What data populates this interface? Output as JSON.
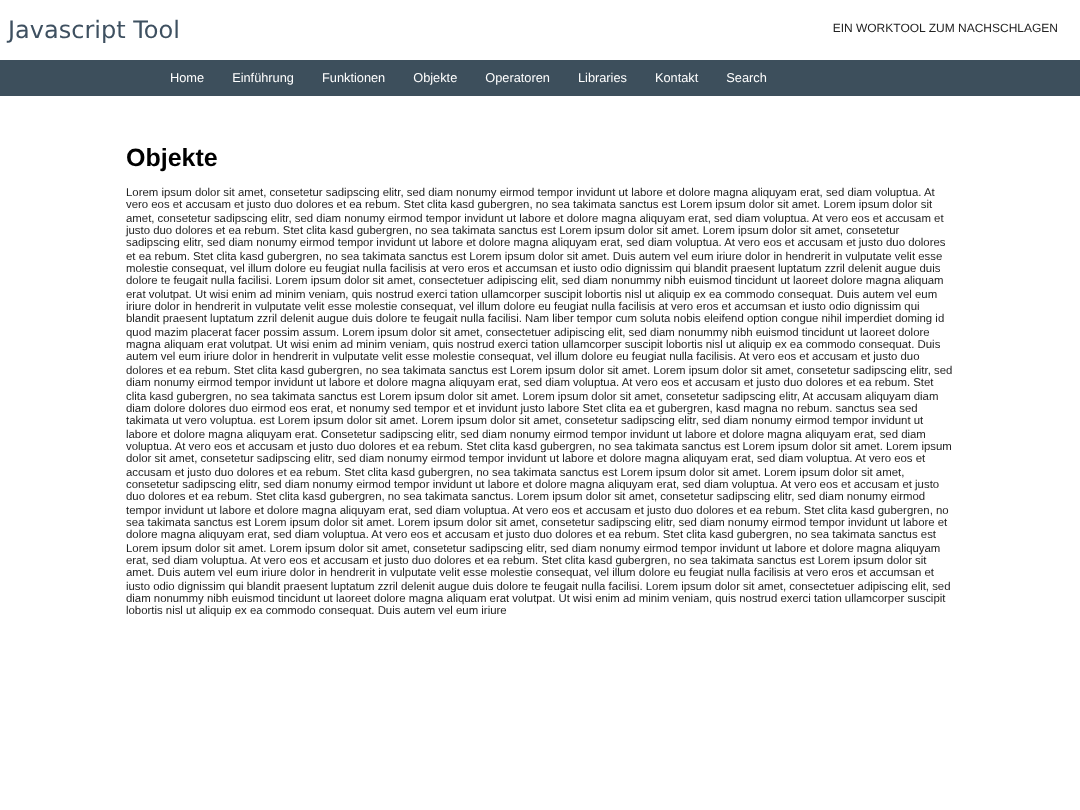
{
  "header": {
    "title": "Javascript Tool",
    "tagline": "EIN WORKTOOL ZUM NACHSCHLAGEN"
  },
  "nav": [
    {
      "label": "Home"
    },
    {
      "label": "Einführung"
    },
    {
      "label": "Funktionen"
    },
    {
      "label": "Objekte"
    },
    {
      "label": "Operatoren"
    },
    {
      "label": "Libraries"
    },
    {
      "label": "Kontakt"
    },
    {
      "label": "Search"
    }
  ],
  "content": {
    "heading": "Objekte",
    "paragraph": "Lorem ipsum dolor sit amet, consetetur sadipscing elitr, sed diam nonumy eirmod tempor invidunt ut labore et dolore magna aliquyam erat, sed diam voluptua. At vero eos et accusam et justo duo dolores et ea rebum. Stet clita kasd gubergren, no sea takimata sanctus est Lorem ipsum dolor sit amet. Lorem ipsum dolor sit amet, consetetur sadipscing elitr, sed diam nonumy eirmod tempor invidunt ut labore et dolore magna aliquyam erat, sed diam voluptua. At vero eos et accusam et justo duo dolores et ea rebum. Stet clita kasd gubergren, no sea takimata sanctus est Lorem ipsum dolor sit amet. Lorem ipsum dolor sit amet, consetetur sadipscing elitr, sed diam nonumy eirmod tempor invidunt ut labore et dolore magna aliquyam erat, sed diam voluptua. At vero eos et accusam et justo duo dolores et ea rebum. Stet clita kasd gubergren, no sea takimata sanctus est Lorem ipsum dolor sit amet. Duis autem vel eum iriure dolor in hendrerit in vulputate velit esse molestie consequat, vel illum dolore eu feugiat nulla facilisis at vero eros et accumsan et iusto odio dignissim qui blandit praesent luptatum zzril delenit augue duis dolore te feugait nulla facilisi. Lorem ipsum dolor sit amet, consectetuer adipiscing elit, sed diam nonummy nibh euismod tincidunt ut laoreet dolore magna aliquam erat volutpat. Ut wisi enim ad minim veniam, quis nostrud exerci tation ullamcorper suscipit lobortis nisl ut aliquip ex ea commodo consequat. Duis autem vel eum iriure dolor in hendrerit in vulputate velit esse molestie consequat, vel illum dolore eu feugiat nulla facilisis at vero eros et accumsan et iusto odio dignissim qui blandit praesent luptatum zzril delenit augue duis dolore te feugait nulla facilisi. Nam liber tempor cum soluta nobis eleifend option congue nihil imperdiet doming id quod mazim placerat facer possim assum. Lorem ipsum dolor sit amet, consectetuer adipiscing elit, sed diam nonummy nibh euismod tincidunt ut laoreet dolore magna aliquam erat volutpat. Ut wisi enim ad minim veniam, quis nostrud exerci tation ullamcorper suscipit lobortis nisl ut aliquip ex ea commodo consequat. Duis autem vel eum iriure dolor in hendrerit in vulputate velit esse molestie consequat, vel illum dolore eu feugiat nulla facilisis. At vero eos et accusam et justo duo dolores et ea rebum. Stet clita kasd gubergren, no sea takimata sanctus est Lorem ipsum dolor sit amet. Lorem ipsum dolor sit amet, consetetur sadipscing elitr, sed diam nonumy eirmod tempor invidunt ut labore et dolore magna aliquyam erat, sed diam voluptua. At vero eos et accusam et justo duo dolores et ea rebum. Stet clita kasd gubergren, no sea takimata sanctus est Lorem ipsum dolor sit amet. Lorem ipsum dolor sit amet, consetetur sadipscing elitr, At accusam aliquyam diam diam dolore dolores duo eirmod eos erat, et nonumy sed tempor et et invidunt justo labore Stet clita ea et gubergren, kasd magna no rebum. sanctus sea sed takimata ut vero voluptua. est Lorem ipsum dolor sit amet. Lorem ipsum dolor sit amet, consetetur sadipscing elitr, sed diam nonumy eirmod tempor invidunt ut labore et dolore magna aliquyam erat. Consetetur sadipscing elitr, sed diam nonumy eirmod tempor invidunt ut labore et dolore magna aliquyam erat, sed diam voluptua. At vero eos et accusam et justo duo dolores et ea rebum. Stet clita kasd gubergren, no sea takimata sanctus est Lorem ipsum dolor sit amet. Lorem ipsum dolor sit amet, consetetur sadipscing elitr, sed diam nonumy eirmod tempor invidunt ut labore et dolore magna aliquyam erat, sed diam voluptua. At vero eos et accusam et justo duo dolores et ea rebum. Stet clita kasd gubergren, no sea takimata sanctus est Lorem ipsum dolor sit amet. Lorem ipsum dolor sit amet, consetetur sadipscing elitr, sed diam nonumy eirmod tempor invidunt ut labore et dolore magna aliquyam erat, sed diam voluptua. At vero eos et accusam et justo duo dolores et ea rebum. Stet clita kasd gubergren, no sea takimata sanctus. Lorem ipsum dolor sit amet, consetetur sadipscing elitr, sed diam nonumy eirmod tempor invidunt ut labore et dolore magna aliquyam erat, sed diam voluptua. At vero eos et accusam et justo duo dolores et ea rebum. Stet clita kasd gubergren, no sea takimata sanctus est Lorem ipsum dolor sit amet. Lorem ipsum dolor sit amet, consetetur sadipscing elitr, sed diam nonumy eirmod tempor invidunt ut labore et dolore magna aliquyam erat, sed diam voluptua. At vero eos et accusam et justo duo dolores et ea rebum. Stet clita kasd gubergren, no sea takimata sanctus est Lorem ipsum dolor sit amet. Lorem ipsum dolor sit amet, consetetur sadipscing elitr, sed diam nonumy eirmod tempor invidunt ut labore et dolore magna aliquyam erat, sed diam voluptua. At vero eos et accusam et justo duo dolores et ea rebum. Stet clita kasd gubergren, no sea takimata sanctus est Lorem ipsum dolor sit amet. Duis autem vel eum iriure dolor in hendrerit in vulputate velit esse molestie consequat, vel illum dolore eu feugiat nulla facilisis at vero eros et accumsan et iusto odio dignissim qui blandit praesent luptatum zzril delenit augue duis dolore te feugait nulla facilisi. Lorem ipsum dolor sit amet, consectetuer adipiscing elit, sed diam nonummy nibh euismod tincidunt ut laoreet dolore magna aliquam erat volutpat. Ut wisi enim ad minim veniam, quis nostrud exerci tation ullamcorper suscipit lobortis nisl ut aliquip ex ea commodo consequat. Duis autem vel eum iriure"
  }
}
